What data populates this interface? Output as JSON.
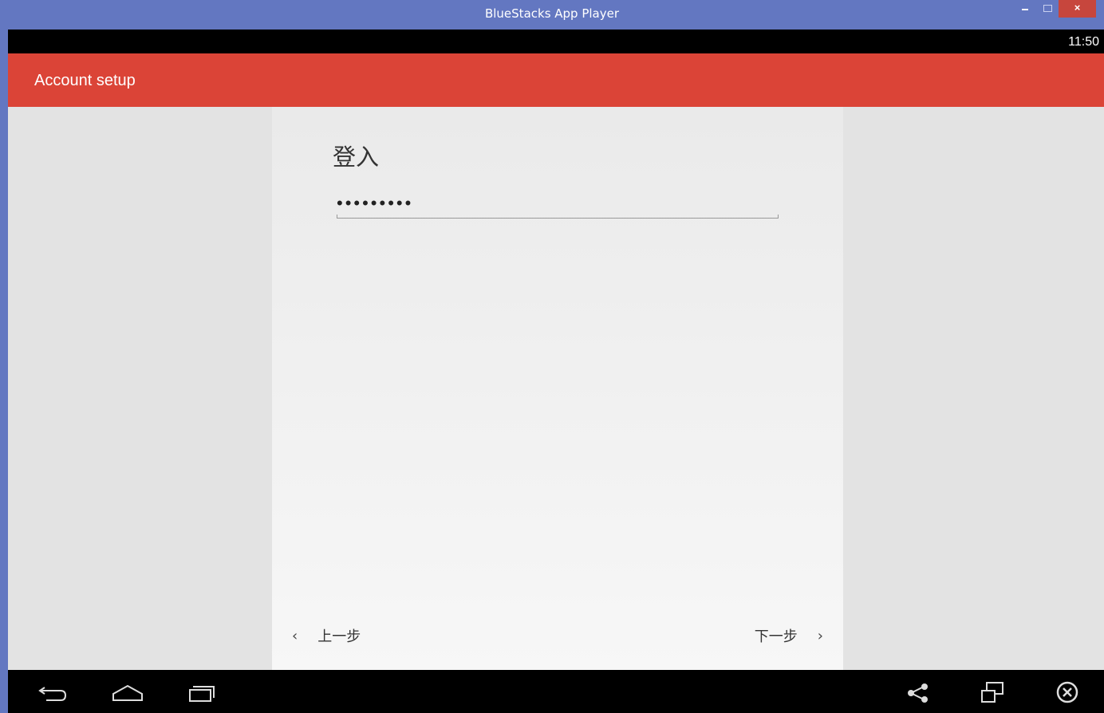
{
  "window": {
    "title": "BlueStacks App Player",
    "min_label": "–",
    "close_label": "×"
  },
  "status": {
    "time": "11:50"
  },
  "appbar": {
    "title": "Account setup"
  },
  "form": {
    "heading": "登入",
    "password_masked": "•••••••••"
  },
  "nav": {
    "back_label": "上一步",
    "next_label": "下一步",
    "back_chevron": "‹",
    "next_chevron": "›"
  },
  "icons": {
    "back": "back-arrow-icon",
    "home": "home-icon",
    "recents": "recent-apps-icon",
    "share": "share-icon",
    "window": "window-mode-icon",
    "close": "close-circle-icon"
  },
  "colors": {
    "titlebar": "#6377c1",
    "appbar": "#db4437",
    "close": "#c7463d"
  }
}
